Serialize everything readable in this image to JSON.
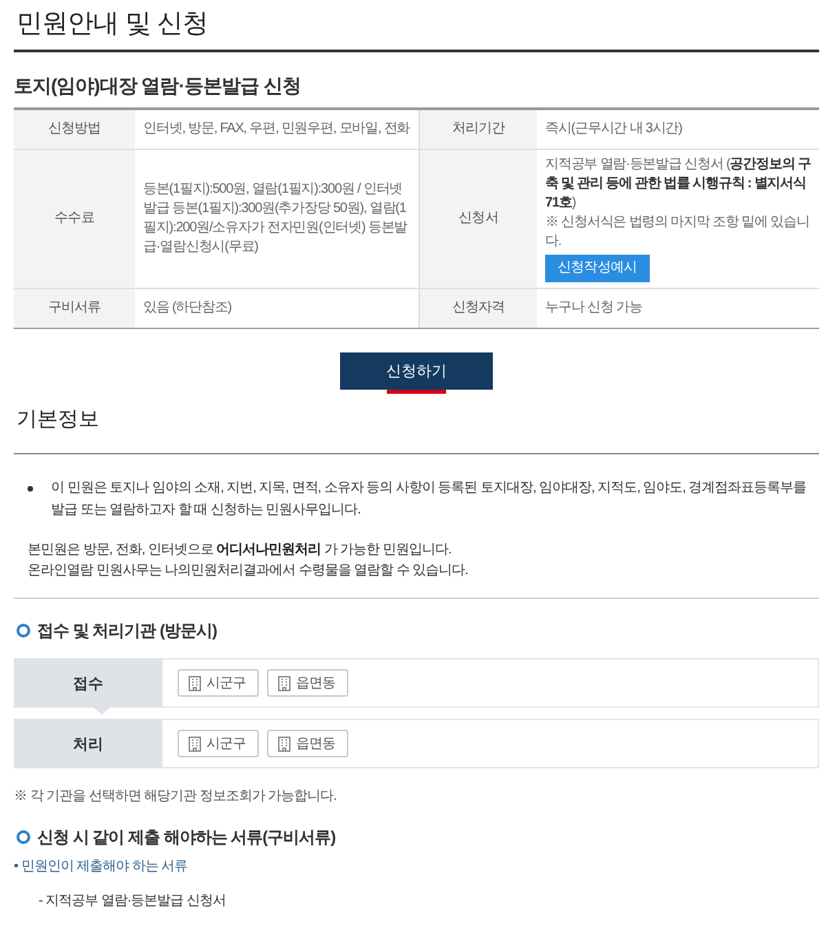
{
  "page": {
    "title": "민원안내 및 신청"
  },
  "service": {
    "title": "토지(임야)대장 열람·등본발급 신청",
    "rows": [
      {
        "cells": [
          {
            "label": "신청방법",
            "kind": "text",
            "value": "인터넷, 방문, FAX, 우편, 민원우편, 모바일, 전화"
          },
          {
            "label": "처리기간",
            "kind": "text",
            "value": "즉시(근무시간 내 3시간)"
          }
        ]
      },
      {
        "cells": [
          {
            "label": "수수료",
            "kind": "text",
            "value": "등본(1필지):500원, 열람(1필지):300원 / 인터넷발급 등본(1필지):300원(추가장당 50원), 열람(1필지):200원/소유자가 전자민원(인터넷) 등본발급·열람신청시(무료)"
          },
          {
            "label": "신청서",
            "kind": "form",
            "paragraphs": [
              "지적공부 열람·등본발급 신청서 (**공간정보의 구축 및 관리 등에 관한 법률 시행규칙 : 별지서식 71호**)",
              "※ 신청서식은 법령의 마지막 조항 밑에 있습니다."
            ],
            "button": "신청작성예시"
          }
        ]
      },
      {
        "cells": [
          {
            "label": "구비서류",
            "kind": "text",
            "value": "있음 (하단참조)"
          },
          {
            "label": "신청자격",
            "kind": "text",
            "value": "누구나 신청 가능"
          }
        ]
      }
    ],
    "apply_button": {
      "label": "신청하기",
      "active": true
    }
  },
  "basic_info": {
    "title": "기본정보",
    "bullets": [
      "이 민원은 토지나 임야의 소재, 지번, 지목, 면적, 소유자 등의 사항이 등록된 토지대장, 임야대장, 지적도, 임야도, 경계점좌표등록부를 발급 또는 열람하고자 할 때 신청하는 민원사무입니다."
    ],
    "notes": [
      "본민원은 방문, 전화, 인터넷으로 **어디서나민원처리** 가 가능한 민원입니다.",
      "온라인열람 민원사무는 나의민원처리결과에서 수령물을 열람할 수 있습니다."
    ]
  },
  "agencies": {
    "title": "접수 및 처리기관 (방문시)",
    "rows": [
      {
        "label": "접수",
        "offices": [
          "시군구",
          "읍면동"
        ]
      },
      {
        "label": "처리",
        "offices": [
          "시군구",
          "읍면동"
        ]
      }
    ],
    "note": "※ 각 기관을 선택하면 해당기관 정보조회가 가능합니다."
  },
  "documents": {
    "title": "신청 시 같이 제출 해야하는 서류(구비서류)",
    "groups": [
      {
        "heading": "• 민원인이 제출해야 하는 서류",
        "items": [
          "- 지적공부 열람·등본발급 신청서"
        ]
      }
    ]
  }
}
